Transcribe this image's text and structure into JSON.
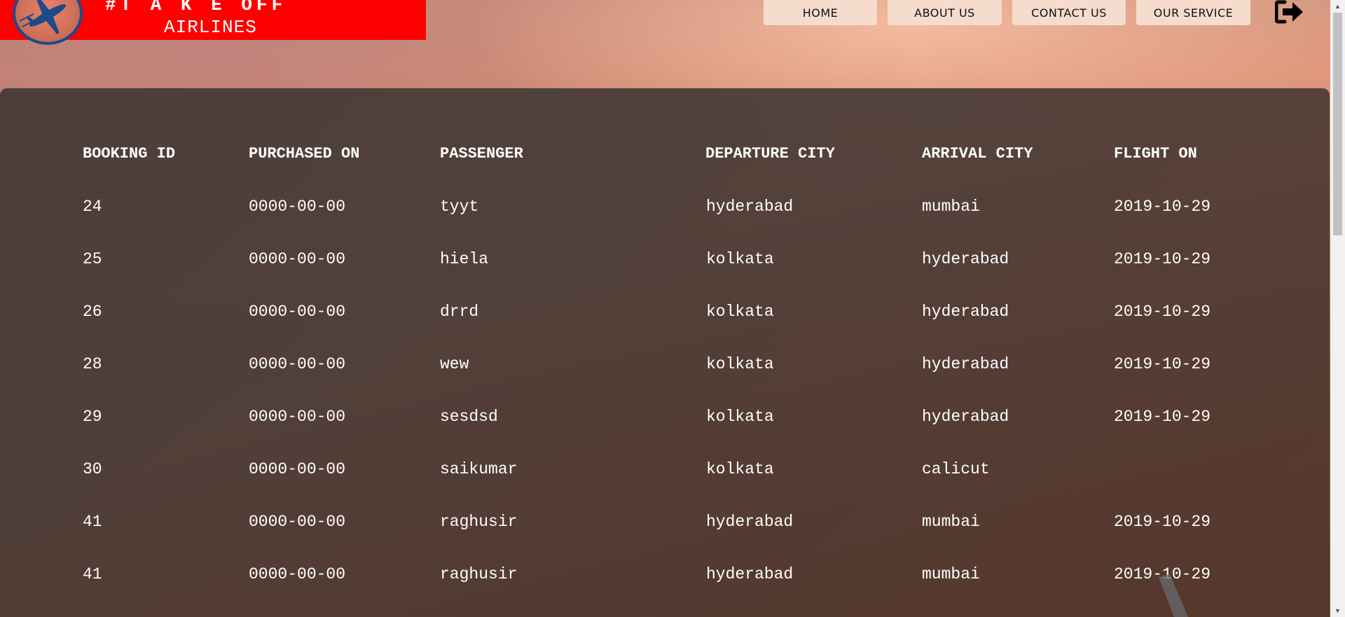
{
  "header": {
    "logo_title": "#T A K E OFF",
    "logo_subtitle": "AIRLINES",
    "logo_color": "#ff0000"
  },
  "nav": {
    "items": [
      {
        "label": "HOME"
      },
      {
        "label": "ABOUT US"
      },
      {
        "label": "CONTACT US"
      },
      {
        "label": "OUR SERVICE"
      }
    ],
    "logout_icon": "sign-out-icon"
  },
  "table": {
    "headers": [
      "BOOKING ID",
      "PURCHASED ON",
      "PASSENGER",
      "DEPARTURE CITY",
      "ARRIVAL CITY",
      "FLIGHT ON"
    ],
    "rows": [
      [
        "24",
        "0000-00-00",
        "tyyt",
        "hyderabad",
        "mumbai",
        "2019-10-29"
      ],
      [
        "25",
        "0000-00-00",
        "hiela",
        "kolkata",
        "hyderabad",
        "2019-10-29"
      ],
      [
        "26",
        "0000-00-00",
        "drrd",
        "kolkata",
        "hyderabad",
        "2019-10-29"
      ],
      [
        "28",
        "0000-00-00",
        "wew",
        "kolkata",
        "hyderabad",
        "2019-10-29"
      ],
      [
        "29",
        "0000-00-00",
        "sesdsd",
        "kolkata",
        "hyderabad",
        "2019-10-29"
      ],
      [
        "30",
        "0000-00-00",
        "saikumar",
        "kolkata",
        "calicut",
        ""
      ],
      [
        "41",
        "0000-00-00",
        "raghusir",
        "hyderabad",
        "mumbai",
        "2019-10-29"
      ],
      [
        "41",
        "0000-00-00",
        "raghusir",
        "hyderabad",
        "mumbai",
        "2019-10-29"
      ]
    ]
  }
}
